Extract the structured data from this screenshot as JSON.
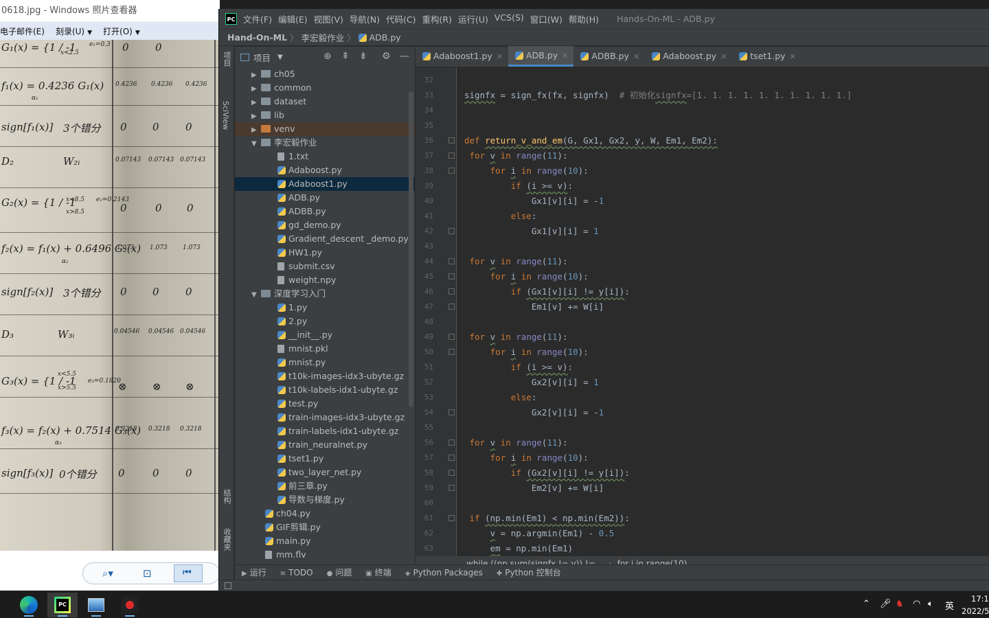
{
  "photo_viewer": {
    "title": "0618.jpg - Windows 照片查看器",
    "menu": [
      "电子邮件(E)",
      "刻录(U)",
      "打开(O)"
    ],
    "handwriting": [
      {
        "text": "G₁(x) = {1 / -1",
        "cls": "big"
      },
      {
        "text": "x<2.5",
        "cls": "sm"
      },
      {
        "text": "e₁=0.3",
        "cls": "sm"
      },
      {
        "text": "0",
        "cls": "big"
      },
      {
        "text": "0",
        "cls": "big"
      },
      {
        "text": "f₁(x) = 0.4236 G₁(x)",
        "cls": "big"
      },
      {
        "text": "α₁",
        "cls": "sm"
      },
      {
        "text": "0.4236",
        "cls": "sm"
      },
      {
        "text": "0.4236",
        "cls": "sm"
      },
      {
        "text": "0.4236",
        "cls": "sm"
      },
      {
        "text": "sign[f₁(x)]",
        "cls": "big"
      },
      {
        "text": "3个错分",
        "cls": "big"
      },
      {
        "text": "0",
        "cls": "big"
      },
      {
        "text": "0",
        "cls": "big"
      },
      {
        "text": "0",
        "cls": "big"
      },
      {
        "text": "D₂",
        "cls": "big"
      },
      {
        "text": "W₂ᵢ",
        "cls": "big"
      },
      {
        "text": "0.07143",
        "cls": "sm"
      },
      {
        "text": "0.07143",
        "cls": "sm"
      },
      {
        "text": "0.07143",
        "cls": "sm"
      },
      {
        "text": "G₂(x) = {1 / -1",
        "cls": "big"
      },
      {
        "text": "x<8.5",
        "cls": "sm"
      },
      {
        "text": "x>8.5",
        "cls": "sm"
      },
      {
        "text": "e₂=0.2143",
        "cls": "sm"
      },
      {
        "text": "0",
        "cls": "big"
      },
      {
        "text": "0",
        "cls": "big"
      },
      {
        "text": "0",
        "cls": "big"
      },
      {
        "text": "f₂(x) = f₁(x) + 0.6496 G₂(x)",
        "cls": "big"
      },
      {
        "text": "α₂",
        "cls": "sm"
      },
      {
        "text": "1.073",
        "cls": "sm"
      },
      {
        "text": "1.073",
        "cls": "sm"
      },
      {
        "text": "1.073",
        "cls": "sm"
      },
      {
        "text": "sign[f₂(x)]",
        "cls": "big"
      },
      {
        "text": "3个错分",
        "cls": "big"
      },
      {
        "text": "0",
        "cls": "big"
      },
      {
        "text": "0",
        "cls": "big"
      },
      {
        "text": "0",
        "cls": "big"
      },
      {
        "text": "D₃",
        "cls": "big"
      },
      {
        "text": "W₃ᵢ",
        "cls": "big"
      },
      {
        "text": "0.04546",
        "cls": "sm"
      },
      {
        "text": "0.04546",
        "cls": "sm"
      },
      {
        "text": "0.04546",
        "cls": "sm"
      },
      {
        "text": "G₃(x) = {1 / -1",
        "cls": "big"
      },
      {
        "text": "x<5.5",
        "cls": "sm"
      },
      {
        "text": "x>5.5",
        "cls": "sm"
      },
      {
        "text": "e₃=0.1820",
        "cls": "sm"
      },
      {
        "text": "⊗",
        "cls": "big"
      },
      {
        "text": "⊗",
        "cls": "big"
      },
      {
        "text": "⊗",
        "cls": "big"
      },
      {
        "text": "f₃(x) = f₂(x) + 0.7514 G₃(x)",
        "cls": "big"
      },
      {
        "text": "α₃",
        "cls": "sm"
      },
      {
        "text": "0.3218",
        "cls": "sm"
      },
      {
        "text": "0.3218",
        "cls": "sm"
      },
      {
        "text": "0.3218",
        "cls": "sm"
      },
      {
        "text": "sign[f₃(x)]",
        "cls": "big"
      },
      {
        "text": "0个错分",
        "cls": "big"
      },
      {
        "text": "0",
        "cls": "big"
      },
      {
        "text": "0",
        "cls": "big"
      },
      {
        "text": "0",
        "cls": "big"
      }
    ]
  },
  "ide": {
    "menu": [
      "文件(F)",
      "编辑(E)",
      "视图(V)",
      "导航(N)",
      "代码(C)",
      "重构(R)",
      "运行(U)",
      "VCS(S)",
      "窗口(W)",
      "帮助(H)"
    ],
    "window_title": "Hands-On-ML - ADB.py",
    "breadcrumb": {
      "project": "Hand-On-ML",
      "folder": "李宏毅作业",
      "file": "ADB.py"
    },
    "left_strip": {
      "project": "项目",
      "sciview": "SciView",
      "structure": "结构",
      "favorites": "收藏夹"
    },
    "project_panel_title": "项目",
    "tree": [
      {
        "label": "ch05",
        "type": "folder",
        "indent": 1,
        "arrow": "›"
      },
      {
        "label": "common",
        "type": "folder",
        "indent": 1,
        "arrow": "›"
      },
      {
        "label": "dataset",
        "type": "folder",
        "indent": 1,
        "arrow": "›"
      },
      {
        "label": "lib",
        "type": "folder",
        "indent": 1,
        "arrow": "›"
      },
      {
        "label": "venv",
        "type": "folder-orange",
        "indent": 1,
        "arrow": "›",
        "state": "hl"
      },
      {
        "label": "李宏毅作业",
        "type": "folder",
        "indent": 1,
        "arrow": "⌄"
      },
      {
        "label": "1.txt",
        "type": "file",
        "indent": 2
      },
      {
        "label": "Adaboost.py",
        "type": "py",
        "indent": 2
      },
      {
        "label": "Adaboost1.py",
        "type": "py",
        "indent": 2,
        "state": "sel"
      },
      {
        "label": "ADB.py",
        "type": "py",
        "indent": 2
      },
      {
        "label": "ADBB.py",
        "type": "py",
        "indent": 2
      },
      {
        "label": "gd_demo.py",
        "type": "py",
        "indent": 2
      },
      {
        "label": "Gradient_descent _demo.py",
        "type": "py",
        "indent": 2
      },
      {
        "label": "HW1.py",
        "type": "py",
        "indent": 2
      },
      {
        "label": "submit.csv",
        "type": "file",
        "indent": 2
      },
      {
        "label": "weight.npy",
        "type": "file",
        "indent": 2
      },
      {
        "label": "深度学习入门",
        "type": "folder-pkg",
        "indent": 1,
        "arrow": "⌄"
      },
      {
        "label": "1.py",
        "type": "py",
        "indent": 2
      },
      {
        "label": "2.py",
        "type": "py",
        "indent": 2
      },
      {
        "label": "__init__.py",
        "type": "py",
        "indent": 2
      },
      {
        "label": "mnist.pkl",
        "type": "file",
        "indent": 2
      },
      {
        "label": "mnist.py",
        "type": "py",
        "indent": 2
      },
      {
        "label": "t10k-images-idx3-ubyte.gz",
        "type": "py",
        "indent": 2
      },
      {
        "label": "t10k-labels-idx1-ubyte.gz",
        "type": "py",
        "indent": 2
      },
      {
        "label": "test.py",
        "type": "py",
        "indent": 2
      },
      {
        "label": "train-images-idx3-ubyte.gz",
        "type": "py",
        "indent": 2
      },
      {
        "label": "train-labels-idx1-ubyte.gz",
        "type": "py",
        "indent": 2
      },
      {
        "label": "train_neuralnet.py",
        "type": "py",
        "indent": 2
      },
      {
        "label": "tset1.py",
        "type": "py",
        "indent": 2
      },
      {
        "label": "two_layer_net.py",
        "type": "py",
        "indent": 2
      },
      {
        "label": "前三章.py",
        "type": "py",
        "indent": 2
      },
      {
        "label": "导数与梯度.py",
        "type": "py",
        "indent": 2
      },
      {
        "label": "ch04.py",
        "type": "py",
        "indent": 0
      },
      {
        "label": "GIF剪辑.py",
        "type": "py",
        "indent": 0
      },
      {
        "label": "main.py",
        "type": "py",
        "indent": 0
      },
      {
        "label": "mm.flv",
        "type": "file",
        "indent": 0
      }
    ],
    "tabs": [
      {
        "label": "Adaboost1.py",
        "active": false
      },
      {
        "label": "ADB.py",
        "active": true
      },
      {
        "label": "ADBB.py",
        "active": false
      },
      {
        "label": "Adaboost.py",
        "active": false
      },
      {
        "label": "tset1.py",
        "active": false
      }
    ],
    "code": [
      {
        "n": "32",
        "t": [],
        "fold": false
      },
      {
        "n": "33",
        "t": [
          [
            "",
            "signfx",
            1
          ],
          [
            "",
            " = sign_fx(fx, signfx)  "
          ],
          [
            "cm",
            "# 初始化"
          ],
          [
            "cm",
            "signfx",
            1
          ],
          [
            "cm",
            "=[1. 1. 1. 1. 1. 1. 1. 1. 1. 1.]"
          ]
        ],
        "fold": false
      },
      {
        "n": "34",
        "t": [],
        "fold": false
      },
      {
        "n": "35",
        "t": [],
        "fold": false
      },
      {
        "n": "36",
        "t": [
          [
            "kw",
            "def "
          ],
          [
            "fn",
            "return_v_and_em",
            1
          ],
          [
            "",
            "(",
            1
          ],
          [
            "",
            "G, Gx1, Gx2, y, W, Em1, Em2",
            1
          ],
          [
            "",
            "):",
            1
          ]
        ],
        "fold": true
      },
      {
        "n": "37",
        "t": [
          [
            "",
            " "
          ],
          [
            "kw",
            "for "
          ],
          [
            "",
            "v",
            1
          ],
          [
            "kw",
            " in "
          ],
          [
            "bi",
            "range"
          ],
          [
            "",
            "("
          ],
          [
            "nm",
            "11"
          ],
          [
            "",
            "):"
          ]
        ],
        "fold": true
      },
      {
        "n": "38",
        "t": [
          [
            "",
            "     "
          ],
          [
            "kw",
            "for "
          ],
          [
            "",
            "i",
            1
          ],
          [
            "kw",
            " in "
          ],
          [
            "bi",
            "range"
          ],
          [
            "",
            "("
          ],
          [
            "nm",
            "10"
          ],
          [
            "",
            "):"
          ]
        ],
        "fold": true
      },
      {
        "n": "39",
        "t": [
          [
            "",
            "         "
          ],
          [
            "kw",
            "if "
          ],
          [
            "",
            "(i >= v)",
            1
          ],
          [
            "",
            ":"
          ]
        ],
        "fold": false
      },
      {
        "n": "40",
        "t": [
          [
            "",
            "             Gx1[v][i] = -"
          ],
          [
            "nm",
            "1"
          ]
        ],
        "fold": false
      },
      {
        "n": "41",
        "t": [
          [
            "",
            "         "
          ],
          [
            "kw",
            "else"
          ],
          [
            "",
            ":"
          ]
        ],
        "fold": false
      },
      {
        "n": "42",
        "t": [
          [
            "",
            "             Gx1[v][i] = "
          ],
          [
            "nm",
            "1"
          ]
        ],
        "fold": true
      },
      {
        "n": "43",
        "t": [],
        "fold": false
      },
      {
        "n": "44",
        "t": [
          [
            "",
            " "
          ],
          [
            "kw",
            "for "
          ],
          [
            "",
            "v",
            1
          ],
          [
            "kw",
            " in "
          ],
          [
            "bi",
            "range"
          ],
          [
            "",
            "("
          ],
          [
            "nm",
            "11"
          ],
          [
            "",
            "):"
          ]
        ],
        "fold": true
      },
      {
        "n": "45",
        "t": [
          [
            "",
            "     "
          ],
          [
            "kw",
            "for "
          ],
          [
            "",
            "i",
            1
          ],
          [
            "kw",
            " in "
          ],
          [
            "bi",
            "range"
          ],
          [
            "",
            "("
          ],
          [
            "nm",
            "10"
          ],
          [
            "",
            "):"
          ]
        ],
        "fold": true
      },
      {
        "n": "46",
        "t": [
          [
            "",
            "         "
          ],
          [
            "kw",
            "if "
          ],
          [
            "",
            "(Gx1[v][i] != y[i])",
            1
          ],
          [
            "",
            ":"
          ]
        ],
        "fold": true
      },
      {
        "n": "47",
        "t": [
          [
            "",
            "             Em1[v] += W[i]"
          ]
        ],
        "fold": true
      },
      {
        "n": "48",
        "t": [],
        "fold": false
      },
      {
        "n": "49",
        "t": [
          [
            "",
            " "
          ],
          [
            "kw",
            "for "
          ],
          [
            "",
            "v",
            1
          ],
          [
            "kw",
            " in "
          ],
          [
            "bi",
            "range"
          ],
          [
            "",
            "("
          ],
          [
            "nm",
            "11"
          ],
          [
            "",
            "):"
          ]
        ],
        "fold": true
      },
      {
        "n": "50",
        "t": [
          [
            "",
            "     "
          ],
          [
            "kw",
            "for "
          ],
          [
            "",
            "i",
            1
          ],
          [
            "kw",
            " in "
          ],
          [
            "bi",
            "range"
          ],
          [
            "",
            "("
          ],
          [
            "nm",
            "10"
          ],
          [
            "",
            "):"
          ]
        ],
        "fold": true
      },
      {
        "n": "51",
        "t": [
          [
            "",
            "         "
          ],
          [
            "kw",
            "if "
          ],
          [
            "",
            "(i >= v)",
            1
          ],
          [
            "",
            ":"
          ]
        ],
        "fold": false
      },
      {
        "n": "52",
        "t": [
          [
            "",
            "             Gx2[v][i] = "
          ],
          [
            "nm",
            "1"
          ]
        ],
        "fold": false
      },
      {
        "n": "53",
        "t": [
          [
            "",
            "         "
          ],
          [
            "kw",
            "else"
          ],
          [
            "",
            ":"
          ]
        ],
        "fold": false
      },
      {
        "n": "54",
        "t": [
          [
            "",
            "             Gx2[v][i] = -"
          ],
          [
            "nm",
            "1"
          ]
        ],
        "fold": true
      },
      {
        "n": "55",
        "t": [],
        "fold": false
      },
      {
        "n": "56",
        "t": [
          [
            "",
            " "
          ],
          [
            "kw",
            "for "
          ],
          [
            "",
            "v",
            1
          ],
          [
            "kw",
            " in "
          ],
          [
            "bi",
            "range"
          ],
          [
            "",
            "("
          ],
          [
            "nm",
            "11"
          ],
          [
            "",
            "):"
          ]
        ],
        "fold": true
      },
      {
        "n": "57",
        "t": [
          [
            "",
            "     "
          ],
          [
            "kw",
            "for "
          ],
          [
            "",
            "i",
            1
          ],
          [
            "kw",
            " in "
          ],
          [
            "bi",
            "range"
          ],
          [
            "",
            "("
          ],
          [
            "nm",
            "10"
          ],
          [
            "",
            "):"
          ]
        ],
        "fold": true
      },
      {
        "n": "58",
        "t": [
          [
            "",
            "         "
          ],
          [
            "kw",
            "if "
          ],
          [
            "",
            "(Gx2[v][i] != y[i])",
            1
          ],
          [
            "",
            ":"
          ]
        ],
        "fold": true
      },
      {
        "n": "59",
        "t": [
          [
            "",
            "             Em2[v] += W[i]"
          ]
        ],
        "fold": true
      },
      {
        "n": "60",
        "t": [],
        "fold": false
      },
      {
        "n": "61",
        "t": [
          [
            "",
            " "
          ],
          [
            "kw",
            "if "
          ],
          [
            "",
            "(np.min(Em1) < np.min(Em2))",
            1
          ],
          [
            "",
            ":"
          ]
        ],
        "fold": true
      },
      {
        "n": "62",
        "t": [
          [
            "",
            "     "
          ],
          [
            "",
            "v",
            1
          ],
          [
            "",
            " = np.argmin(Em1) - "
          ],
          [
            "nm",
            "0.5"
          ]
        ],
        "fold": false
      },
      {
        "n": "63",
        "t": [
          [
            "",
            "     "
          ],
          [
            "",
            "em",
            1
          ],
          [
            "",
            " = np.min(Em1)"
          ]
        ],
        "fold": false
      }
    ],
    "status_breadcrumb": [
      "while ((np.sum(signfx != y)) !=...",
      "for i in range(10)"
    ],
    "bottom_tools": [
      {
        "icon": "▶",
        "label": "运行"
      },
      {
        "icon": "≡",
        "label": "TODO"
      },
      {
        "icon": "●",
        "label": "问题"
      },
      {
        "icon": "▣",
        "label": "终端"
      },
      {
        "icon": "◈",
        "label": "Python Packages"
      },
      {
        "icon": "✚",
        "label": "Python 控制台"
      }
    ]
  },
  "taskbar": {
    "apps": [
      "edge-icon",
      "pycharm-icon",
      "photos-icon",
      "recorder-icon"
    ],
    "ime": "英",
    "time": "17:1",
    "date": "2022/5"
  }
}
